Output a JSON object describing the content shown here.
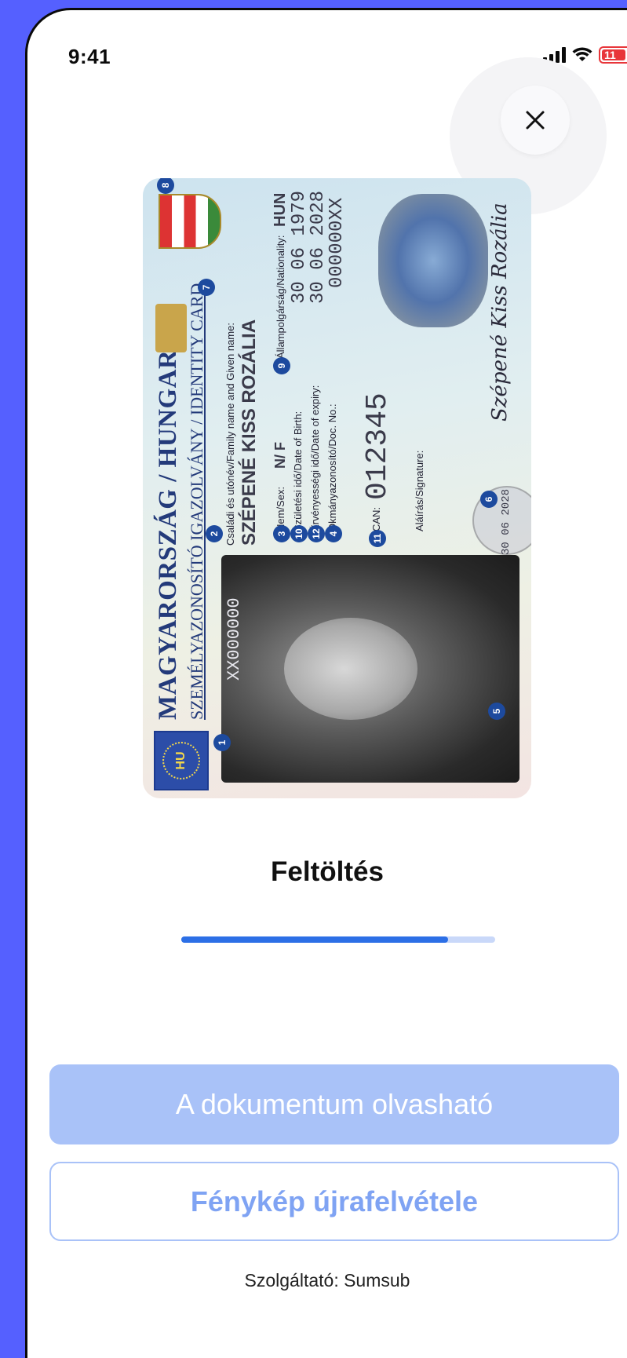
{
  "status_bar": {
    "time": "9:41",
    "battery_level": "11",
    "colors": {
      "battery": "#e8363a"
    }
  },
  "header": {
    "close_icon": "close-icon"
  },
  "id_card": {
    "title": "MAGYARORSZÁG / HUNGARY",
    "subtitle": "SZEMÉLYAZONOSÍTÓ IGAZOLVÁNY / IDENTITY CARD",
    "flag_text": "HU",
    "name_label": "Családi és utónév/Family name and Given name:",
    "name": "SZÉPENÉ KISS ROZÁLIA",
    "sex_label": "Nem/Sex:",
    "sex": "N/ F",
    "birth_label": "Születési idő/Date of Birth:",
    "birth": "30 06 1979",
    "expiry_label": "Érvényességi idő/Date of expiry:",
    "expiry": "30 06 2028",
    "doc_label": "Okmányazonosító/Doc. No.:",
    "doc_no": "000000XX",
    "nationality_label": "Állampolgárság/Nationality:",
    "nationality": "HUN",
    "can_label": "CAN:",
    "can": "012345",
    "signature_label": "Aláírás/Signature:",
    "signature": "Szépené Kiss Rozália",
    "photo_code": "XX000000",
    "seal_date": "30 06 2028",
    "markers": [
      "1",
      "2",
      "3",
      "4",
      "5",
      "6",
      "7",
      "8",
      "9",
      "10",
      "11",
      "12"
    ]
  },
  "upload": {
    "title": "Feltöltés",
    "progress": 0.85,
    "colors": {
      "fill": "#2c6fe6",
      "track": "#c9d8f9"
    }
  },
  "buttons": {
    "primary_label": "A dokumentum olvasható",
    "secondary_label": "Fénykép újrafelvétele"
  },
  "footer": {
    "provider": "Szolgáltató: Sumsub"
  }
}
